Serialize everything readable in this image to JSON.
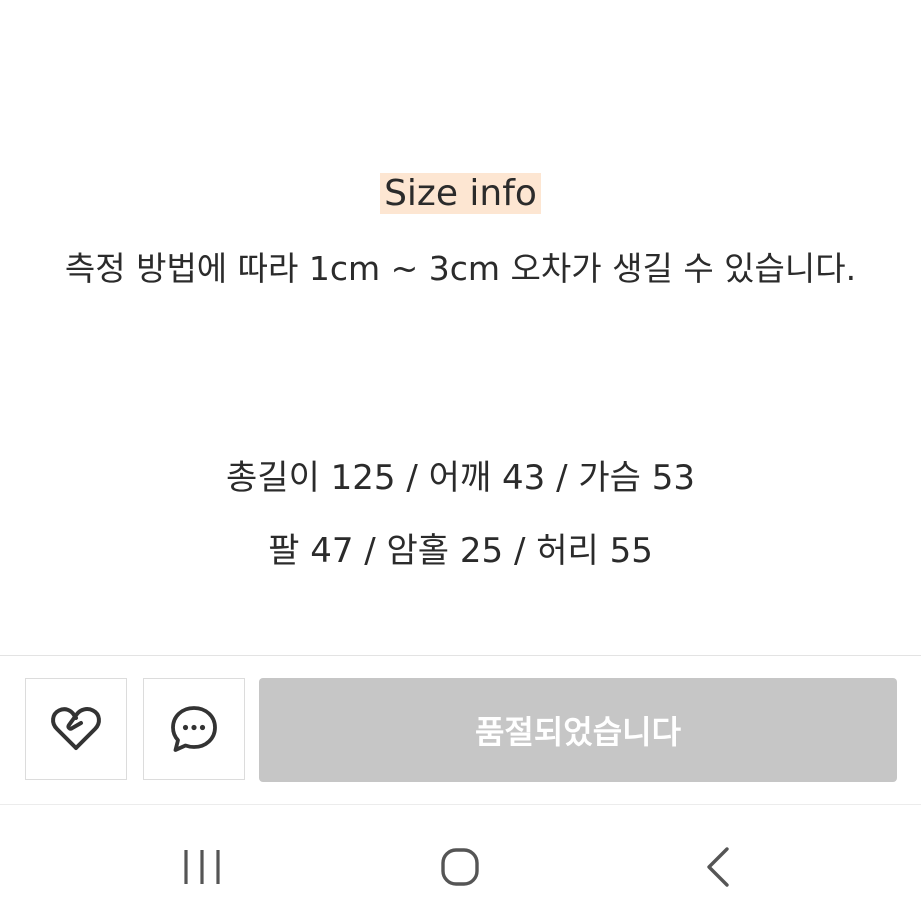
{
  "content": {
    "size_title": "Size info",
    "notice": "측정 방법에 따라 1cm ~ 3cm 오차가 생길 수 있습니다.",
    "measure_line1": "총길이 125 / 어깨 43 / 가슴 53",
    "measure_line2": "팔 47 / 암홀 25 / 허리 55",
    "highlight_color": "#fde6d2"
  },
  "action_bar": {
    "like_icon": "heart-icon",
    "chat_icon": "chat-bubble-icon",
    "soldout_label": "품절되었습니다",
    "soldout_color": "#c6c6c6"
  },
  "nav_bar": {
    "icons": [
      "recent-apps-icon",
      "home-icon",
      "back-icon"
    ]
  }
}
